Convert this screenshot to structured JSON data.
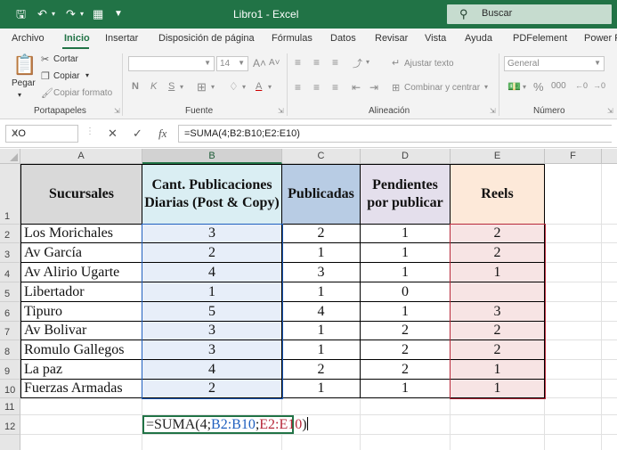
{
  "window": {
    "title": "Libro1  -  Excel",
    "search_placeholder": "Buscar"
  },
  "menu": {
    "tabs": [
      "Archivo",
      "Inicio",
      "Insertar",
      "Disposición de página",
      "Fórmulas",
      "Datos",
      "Revisar",
      "Vista",
      "Ayuda",
      "PDFelement",
      "Power P"
    ],
    "active": "Inicio"
  },
  "ribbon": {
    "clipboard": {
      "paste": "Pegar",
      "cut": "Cortar",
      "copy": "Copiar",
      "format_painter": "Copiar formato",
      "label": "Portapapeles"
    },
    "font": {
      "size": "14",
      "label": "Fuente"
    },
    "alignment": {
      "wrap": "Ajustar texto",
      "merge": "Combinar y centrar",
      "label": "Alineación"
    },
    "number": {
      "format": "General",
      "label": "Número"
    }
  },
  "formula_bar": {
    "name_box": "XO",
    "formula": "=SUMA(4;B2:B10;E2:E10)"
  },
  "sheet": {
    "columns": [
      "A",
      "B",
      "C",
      "D",
      "E",
      "F"
    ],
    "rows": [
      "1",
      "2",
      "3",
      "4",
      "5",
      "6",
      "7",
      "8",
      "9",
      "10",
      "11",
      "12"
    ],
    "headers": {
      "sucursales": "Sucursales",
      "cant": "Cant. Publicaciones Diarias (Post & Copy)",
      "publicadas": "Publicadas",
      "pendientes": "Pendientes por publicar",
      "reels": "Reels"
    },
    "data": [
      {
        "sucursal": "Los Morichales",
        "cant": "3",
        "publicadas": "2",
        "pendientes": "1",
        "reels": "2"
      },
      {
        "sucursal": "Av García",
        "cant": "2",
        "publicadas": "1",
        "pendientes": "1",
        "reels": "2"
      },
      {
        "sucursal": "Av Alirio Ugarte",
        "cant": "4",
        "publicadas": "3",
        "pendientes": "1",
        "reels": "1"
      },
      {
        "sucursal": "Libertador",
        "cant": "1",
        "publicadas": "1",
        "pendientes": "0",
        "reels": ""
      },
      {
        "sucursal": "Tipuro",
        "cant": "5",
        "publicadas": "4",
        "pendientes": "1",
        "reels": "3"
      },
      {
        "sucursal": "Av Bolivar",
        "cant": "3",
        "publicadas": "1",
        "pendientes": "2",
        "reels": "2"
      },
      {
        "sucursal": "Romulo Gallegos",
        "cant": "3",
        "publicadas": "1",
        "pendientes": "2",
        "reels": "2"
      },
      {
        "sucursal": "La paz",
        "cant": "4",
        "publicadas": "2",
        "pendientes": "2",
        "reels": "1"
      },
      {
        "sucursal": "Fuerzas Armadas",
        "cant": "2",
        "publicadas": "1",
        "pendientes": "1",
        "reels": "1"
      }
    ],
    "editing_cell": {
      "prefix": "=SUMA(4;",
      "ref1": "B2:B10",
      "sep": ";",
      "ref2": "E2:E10",
      "suffix": ")"
    }
  },
  "colors": {
    "excel_green": "#217346",
    "header_gray": "#d9d9d9",
    "cant_header": "#daeef3",
    "cant_cells": "#e7eef9",
    "pub_header": "#b8cce4",
    "pend_header": "#e4dfec",
    "reels_header": "#fde9d9",
    "reels_cells": "#f7e4e4"
  }
}
